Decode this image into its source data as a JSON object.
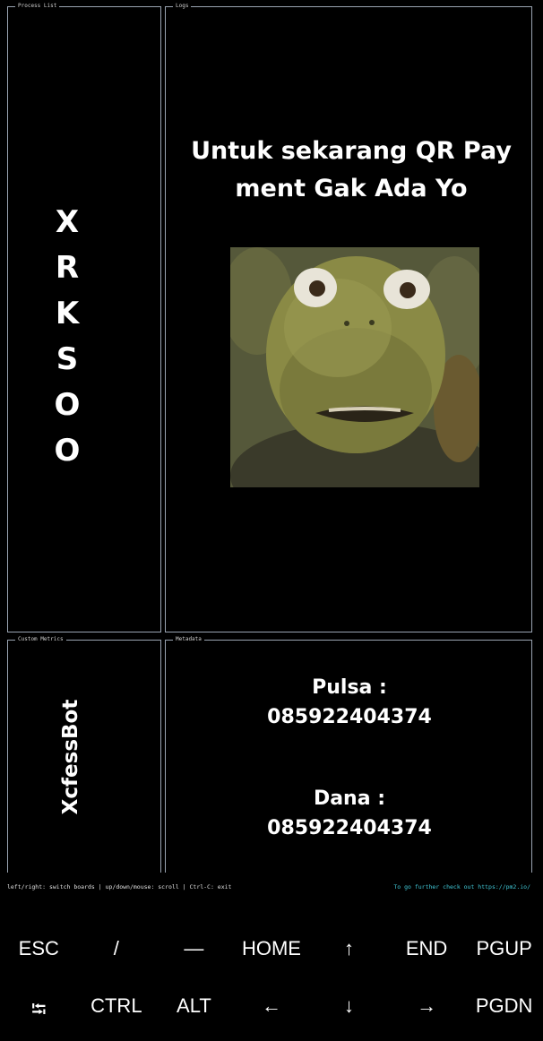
{
  "panels": {
    "process_list": {
      "title": "Process List",
      "letters": [
        "X",
        "R",
        "K",
        "S",
        "O",
        "O"
      ]
    },
    "logs": {
      "title": "Logs",
      "message_line1": "Untuk sekarang QR Pay",
      "message_line2": "ment Gak Ada Yo"
    },
    "custom_metrics": {
      "title": "Custom Metrics",
      "vertical_label": "XcfessBot"
    },
    "metadata": {
      "title": "Metadata",
      "pulsa_label": "Pulsa :",
      "pulsa_number": "085922404374",
      "dana_label": "Dana :",
      "dana_number": "085922404374"
    }
  },
  "footer": {
    "help_text": "left/right: switch boards | up/down/mouse: scroll | Ctrl-C: exit",
    "link_text": "To go further check out https://pm2.io/"
  },
  "extra_keys": {
    "row1": [
      "ESC",
      "/",
      "—",
      "HOME",
      "↑",
      "END",
      "PGUP"
    ],
    "row2": [
      "⭾",
      "CTRL",
      "ALT",
      "←",
      "↓",
      "→",
      "PGDN"
    ]
  },
  "colors": {
    "background": "#000000",
    "panel_border": "#9aa4b2",
    "link": "#41c9d8"
  }
}
